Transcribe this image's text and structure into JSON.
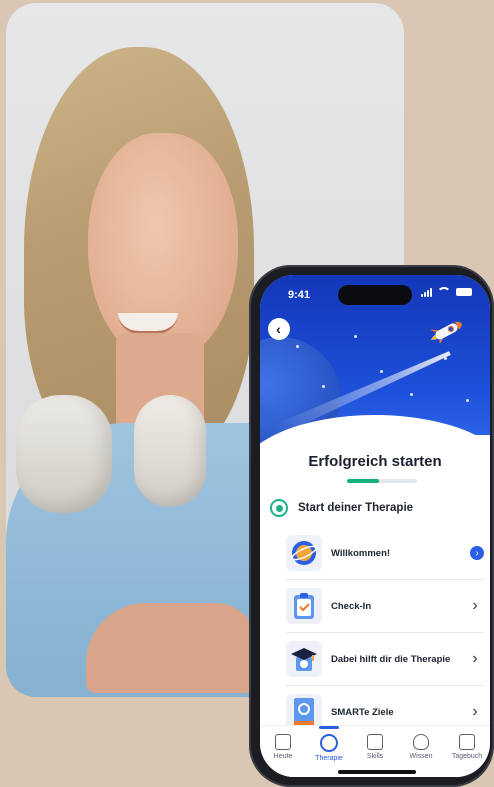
{
  "status_bar": {
    "time": "9:41"
  },
  "screen": {
    "title": "Erfolgreich starten",
    "progress_fraction": 0.45,
    "section_label": "Start deiner Therapie",
    "items": [
      {
        "label": "Willkommen!",
        "icon": "planet-icon",
        "state": "active"
      },
      {
        "label": "Check-In",
        "icon": "clipboard-check-icon",
        "state": "default"
      },
      {
        "label": "Dabei hilft dir die Therapie",
        "icon": "graduation-cap-icon",
        "state": "default"
      },
      {
        "label": "SMARTe Ziele",
        "icon": "book-icon",
        "state": "default"
      }
    ]
  },
  "tabbar": {
    "tabs": [
      {
        "label": "Heute",
        "icon": "calendar-check-icon"
      },
      {
        "label": "Therapie",
        "icon": "ring-icon",
        "active": true
      },
      {
        "label": "Skills",
        "icon": "briefcase-icon"
      },
      {
        "label": "Wissen",
        "icon": "lightbulb-icon"
      },
      {
        "label": "Tagebuch",
        "icon": "notebook-icon"
      }
    ]
  },
  "colors": {
    "accent": "#2a5ee6",
    "success": "#1bb08a",
    "hero": "#1d4fd8",
    "background": "#d9c7b3"
  }
}
